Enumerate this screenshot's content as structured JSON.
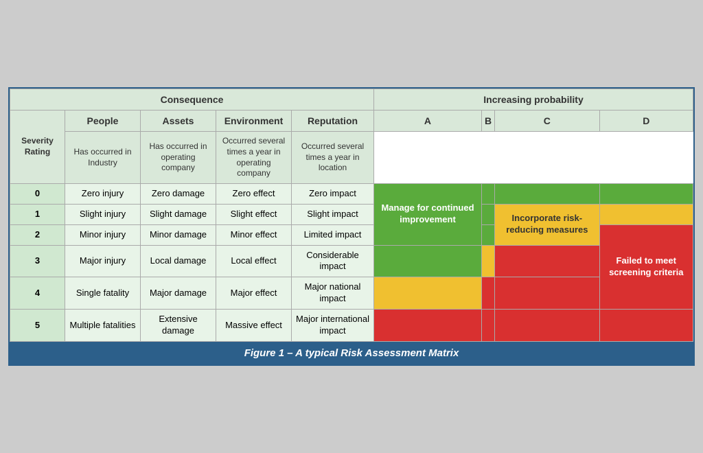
{
  "caption": "Figure 1 – A typical Risk Assessment Matrix",
  "consequence_header": "Consequence",
  "probability_header": "Increasing probability",
  "columns": {
    "severity": "Severity Rating",
    "people": "People",
    "assets": "Assets",
    "environment": "Environment",
    "reputation": "Reputation"
  },
  "prob_columns": [
    {
      "letter": "A",
      "desc": "Has occurred in Industry"
    },
    {
      "letter": "B",
      "desc": "Has occurred in operating company"
    },
    {
      "letter": "C",
      "desc": "Occurred several times a year in operating company"
    },
    {
      "letter": "D",
      "desc": "Occurred several times a year in location"
    }
  ],
  "rows": [
    {
      "severity": "0",
      "people": "Zero injury",
      "assets": "Zero damage",
      "environment": "Zero effect",
      "reputation": "Zero impact"
    },
    {
      "severity": "1",
      "people": "Slight injury",
      "assets": "Slight damage",
      "environment": "Slight effect",
      "reputation": "Slight impact"
    },
    {
      "severity": "2",
      "people": "Minor injury",
      "assets": "Minor damage",
      "environment": "Minor effect",
      "reputation": "Limited impact"
    },
    {
      "severity": "3",
      "people": "Major injury",
      "assets": "Local damage",
      "environment": "Local effect",
      "reputation": "Considerable impact"
    },
    {
      "severity": "4",
      "people": "Single fatality",
      "assets": "Major damage",
      "environment": "Major effect",
      "reputation": "Major national impact"
    },
    {
      "severity": "5",
      "people": "Multiple fatalities",
      "assets": "Extensive damage",
      "environment": "Massive effect",
      "reputation": "Major international impact"
    }
  ],
  "zone_labels": {
    "green": "Manage for continued improvement",
    "yellow": "Incorporate risk-reducing measures",
    "red": "Failed to meet screening criteria"
  }
}
